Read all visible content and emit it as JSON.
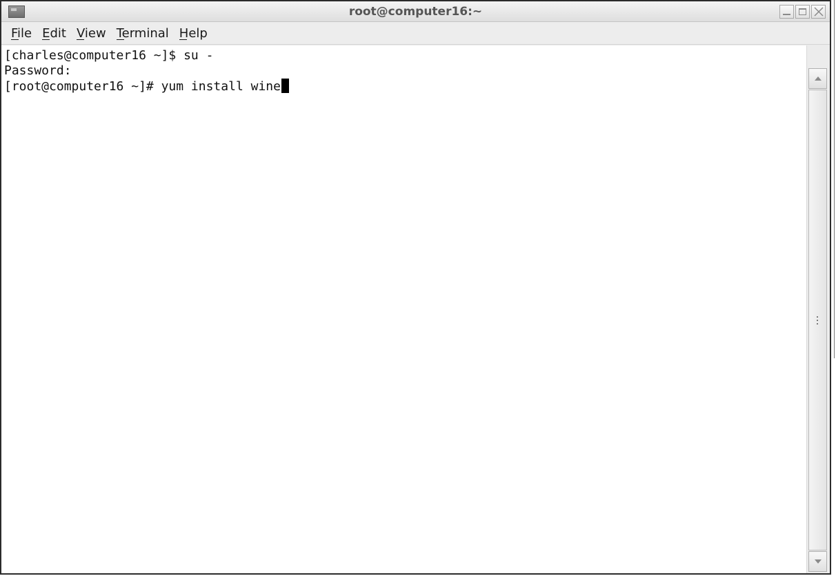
{
  "window": {
    "title": "root@computer16:~"
  },
  "menubar": {
    "items": [
      {
        "label": "File"
      },
      {
        "label": "Edit"
      },
      {
        "label": "View"
      },
      {
        "label": "Terminal"
      },
      {
        "label": "Help"
      }
    ]
  },
  "terminal": {
    "lines": [
      "[charles@computer16 ~]$ su -",
      "Password:",
      "[root@computer16 ~]# yum install wine"
    ]
  },
  "icons": {
    "window_icon": "terminal-icon",
    "minimize": "minimize-icon",
    "maximize": "maximize-icon",
    "close": "close-icon",
    "scroll_up": "arrow-up-icon",
    "scroll_down": "arrow-down-icon"
  }
}
